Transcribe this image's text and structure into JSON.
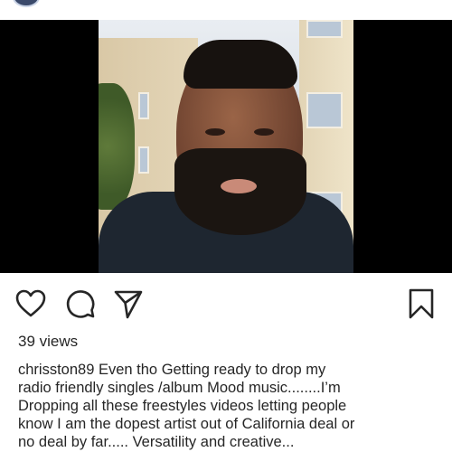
{
  "post": {
    "views_label": "39 views",
    "username": "chrisston89",
    "caption_text": " Even tho Getting ready to drop my\nradio friendly  singles /album Mood  music........I’m\nDropping all these freestyles videos letting people\nknow I am the dopest artist out of California deal or\nno deal by far..... Versatility and creative..."
  },
  "icons": {
    "like": "heart-icon",
    "comment": "comment-icon",
    "share": "send-icon",
    "save": "bookmark-icon"
  },
  "colors": {
    "text": "#262626",
    "icon_stroke": "#262626",
    "video_letterbox": "#000000",
    "background": "#ffffff"
  }
}
